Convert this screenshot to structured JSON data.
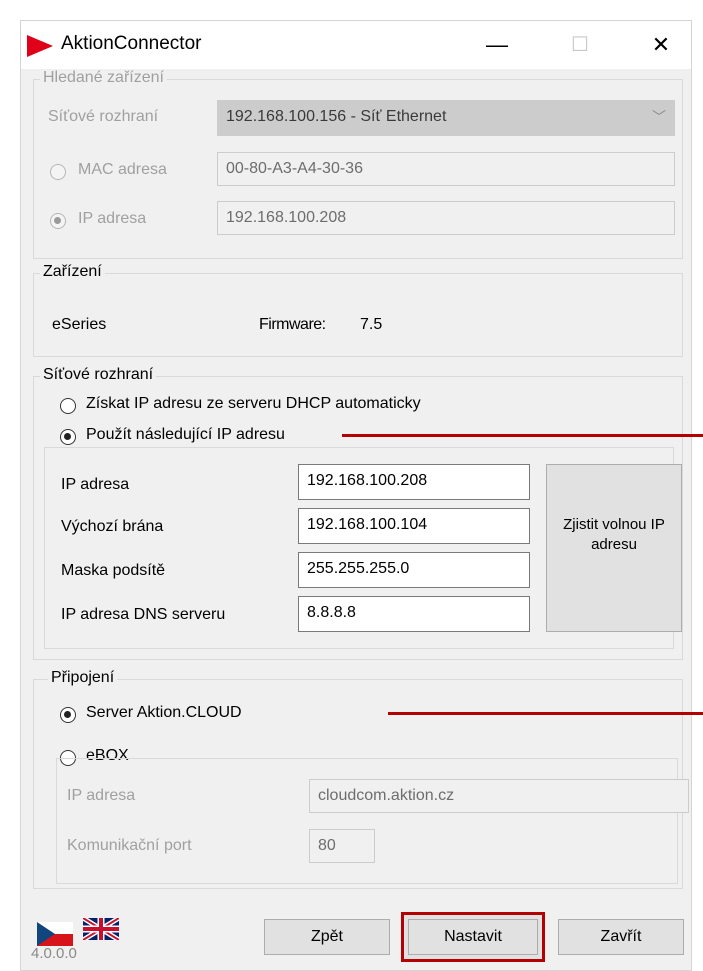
{
  "window": {
    "title": "AktionConnector",
    "controls": {
      "minimize": "—",
      "maximize": "☐",
      "close": "✕"
    }
  },
  "search_device": {
    "group_label": "Hledané zařízení",
    "network_interface_label": "Síťové rozhraní",
    "network_interface_value": "192.168.100.156 - Síť Ethernet",
    "mac_label": "MAC adresa",
    "mac_value": "00-80-A3-A4-30-36",
    "ip_label": "IP adresa",
    "ip_value": "192.168.100.208"
  },
  "device": {
    "group_label": "Zařízení",
    "name": "eSeries",
    "firmware_label": "Firmware:",
    "firmware_value": "7.5"
  },
  "network": {
    "group_label": "Síťové rozhraní",
    "dhcp_option": "Získat IP adresu ze serveru DHCP automaticky",
    "static_option": "Použít následující IP adresu",
    "fields": [
      {
        "label": "IP adresa",
        "value": "192.168.100.208"
      },
      {
        "label": "Výchozí brána",
        "value": "192.168.100.104"
      },
      {
        "label": "Maska podsítě",
        "value": "255.255.255.0"
      },
      {
        "label": "IP adresa DNS serveru",
        "value": "8.8.8.8"
      }
    ],
    "find_ip_button": "Zjistit volnou IP adresu"
  },
  "connection": {
    "group_label": "Připojení",
    "cloud_option": "Server Aktion.CLOUD",
    "ebox_option": "eBOX",
    "ip_label": "IP adresa",
    "ip_value": "cloudcom.aktion.cz",
    "port_label": "Komunikační port",
    "port_value": "80"
  },
  "footer": {
    "version": "4.0.0.0",
    "back_button": "Zpět",
    "set_button": "Nastavit",
    "close_button": "Zavřít"
  },
  "colors": {
    "highlight_red": "#b30000",
    "brand_red": "#e0001a"
  }
}
